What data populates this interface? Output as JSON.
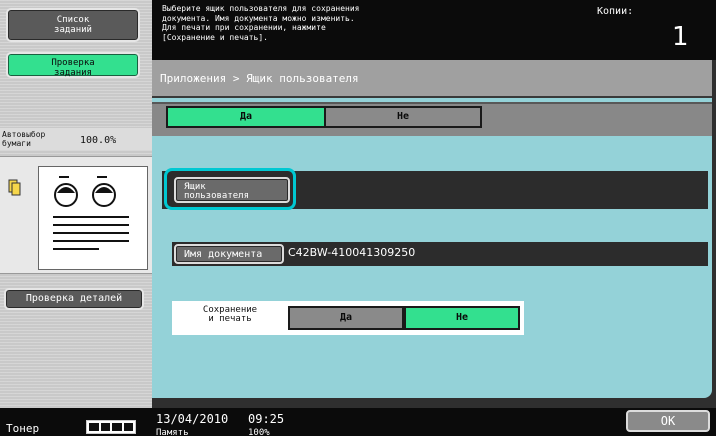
{
  "left": {
    "job_list_label": "Список\nзаданий",
    "job_check_label": "Проверка\nзадания",
    "auto_paper_label": "Автовыбор\nбумаги",
    "zoom_value": "100.0%",
    "details_check_label": "Проверка деталей",
    "toner_label": "Тонер"
  },
  "top": {
    "message": "Выберите ящик пользователя для сохранения\nдокумента. Имя документа можно изменить.\nДля печати при сохранении, нажмите\n[Сохранение и печать].",
    "copies_label": "Копии:",
    "copies_value": "1"
  },
  "main": {
    "breadcrumb": "Приложения > Ящик пользователя",
    "yes_label": "Да",
    "no_label": "Не",
    "user_box_label": "Ящик\nпользователя",
    "user_box_value": "",
    "doc_name_label": "Имя документа",
    "doc_name_value": "C42BW-410041309250",
    "save_print_label": "Сохранение\nи печать",
    "save_print_yes": "Да",
    "save_print_no": "Не"
  },
  "bottom": {
    "date": "13/04/2010",
    "time": "09:25",
    "memory_label": "Память",
    "memory_value": "100%",
    "ok_label": "OK"
  }
}
